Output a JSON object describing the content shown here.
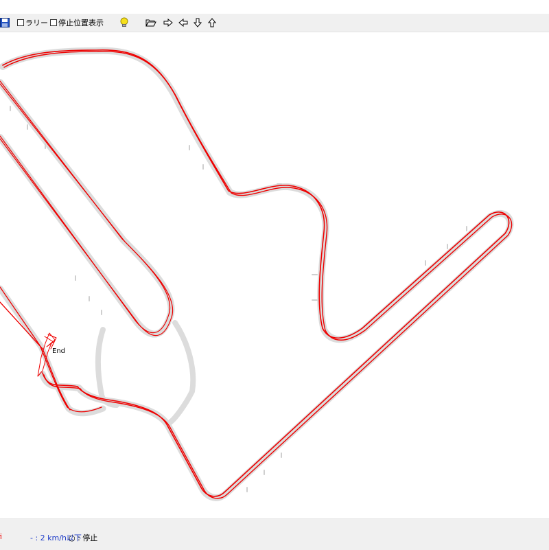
{
  "toolbar": {
    "save_icon": "floppy-disk-icon",
    "rally_label": "ラリー",
    "rally_checked": false,
    "stop_position_label": "停止位置表示",
    "stop_position_checked": false,
    "hint_icon": "lightbulb-icon",
    "open_icon": "folder-open-icon",
    "arrows": [
      "arrow-right-icon",
      "arrow-left-icon",
      "arrow-down-icon",
      "arrow-up-icon"
    ]
  },
  "map": {
    "end_label": "End",
    "track_color": "#dcdcdc",
    "trace_color": "#ee0000"
  },
  "status": {
    "legend_red_text": "fi",
    "legend_speed_text": "- : 2 km/h以下",
    "legend_stop_text": "○ : 停止",
    "red_color": "#ee0000",
    "blue_color": "#1e3cc8"
  }
}
